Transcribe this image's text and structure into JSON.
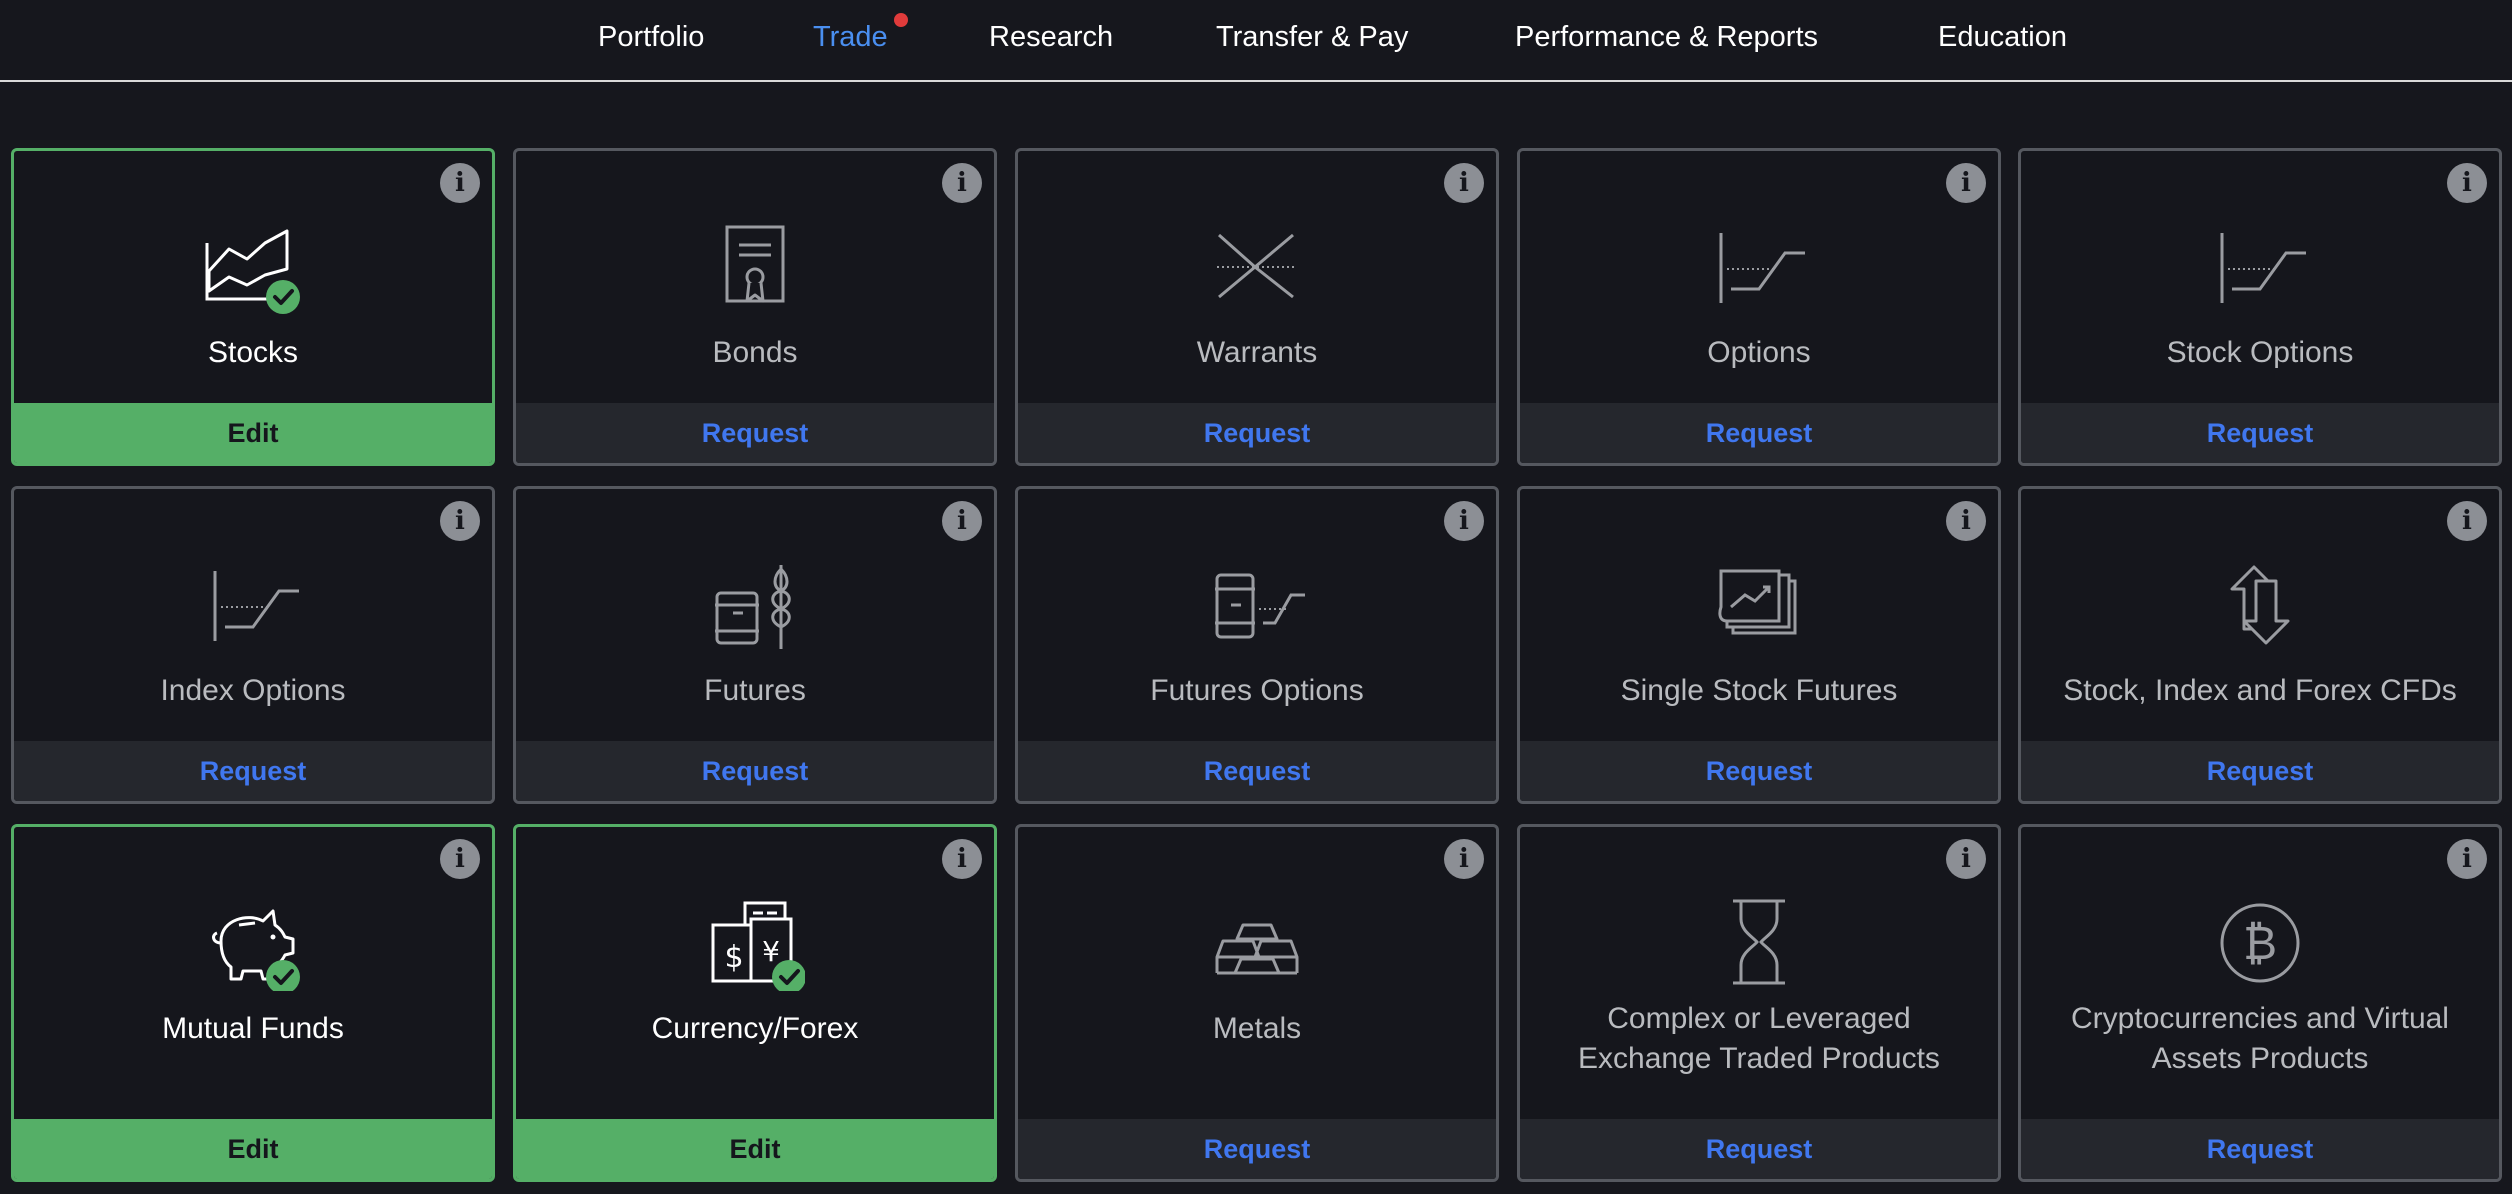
{
  "nav": {
    "items": [
      {
        "label": "Portfolio"
      },
      {
        "label": "Trade"
      },
      {
        "label": "Research"
      },
      {
        "label": "Transfer & Pay"
      },
      {
        "label": "Performance & Reports"
      },
      {
        "label": "Education"
      }
    ],
    "active_item": "Trade",
    "notification_dot": "Trade"
  },
  "info_glyph": "i",
  "cards": [
    {
      "label": "Stocks",
      "action": "Edit",
      "enabled": true,
      "icon": "stock-chart-icon"
    },
    {
      "label": "Bonds",
      "action": "Request",
      "enabled": false,
      "icon": "certificate-icon"
    },
    {
      "label": "Warrants",
      "action": "Request",
      "enabled": false,
      "icon": "crossing-lines-icon"
    },
    {
      "label": "Options",
      "action": "Request",
      "enabled": false,
      "icon": "option-payoff-icon"
    },
    {
      "label": "Stock Options",
      "action": "Request",
      "enabled": false,
      "icon": "option-payoff-icon"
    },
    {
      "label": "Index Options",
      "action": "Request",
      "enabled": false,
      "icon": "option-payoff-icon"
    },
    {
      "label": "Futures",
      "action": "Request",
      "enabled": false,
      "icon": "barrel-wheat-icon"
    },
    {
      "label": "Futures Options",
      "action": "Request",
      "enabled": false,
      "icon": "barrel-option-icon"
    },
    {
      "label": "Single Stock Futures",
      "action": "Request",
      "enabled": false,
      "icon": "stacked-charts-icon"
    },
    {
      "label": "Stock, Index and Forex CFDs",
      "action": "Request",
      "enabled": false,
      "icon": "swap-arrows-icon"
    },
    {
      "label": "Mutual Funds",
      "action": "Edit",
      "enabled": true,
      "icon": "piggy-bank-icon"
    },
    {
      "label": "Currency/Forex",
      "action": "Edit",
      "enabled": true,
      "icon": "currency-notes-icon"
    },
    {
      "label": "Metals",
      "action": "Request",
      "enabled": false,
      "icon": "gold-bars-icon"
    },
    {
      "label": "Complex or Leveraged Exchange Traded Products",
      "action": "Request",
      "enabled": false,
      "icon": "hourglass-icon"
    },
    {
      "label": "Cryptocurrencies and Virtual Assets Products",
      "action": "Request",
      "enabled": false,
      "icon": "bitcoin-icon"
    }
  ],
  "colors": {
    "background": "#16171d",
    "card_background": "#15161c",
    "enabled_green": "#55af67",
    "request_blue": "#4077ef",
    "active_nav_blue": "#4a8ff0",
    "notification_red": "#e03b3b"
  }
}
